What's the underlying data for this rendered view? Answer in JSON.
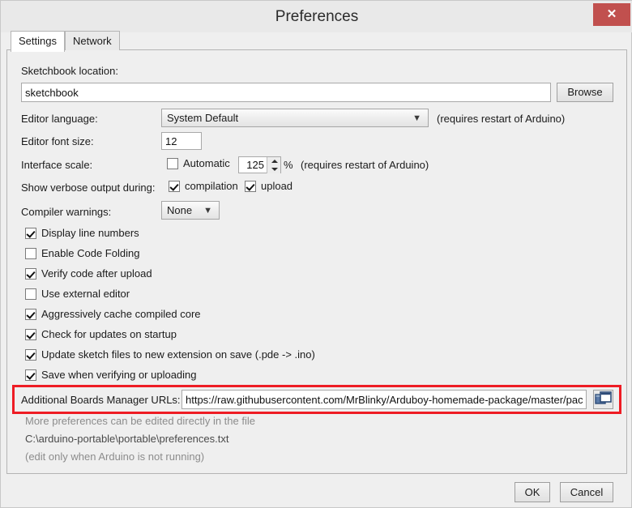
{
  "window": {
    "title": "Preferences",
    "close_label": "✕"
  },
  "tabs": [
    {
      "label": "Settings",
      "active": true
    },
    {
      "label": "Network",
      "active": false
    }
  ],
  "settings": {
    "sketchbook_label": "Sketchbook location:",
    "sketchbook_value": "sketchbook",
    "sketchbook_placeholder": "Sketchbook location",
    "browse_label": "Browse",
    "editor_language_label": "Editor language:",
    "editor_language_value": "System Default",
    "editor_language_note": "(requires restart of Arduino)",
    "editor_font_size_label": "Editor font size:",
    "editor_font_size_value": "12",
    "interface_scale_label": "Interface scale:",
    "interface_scale_auto_label": "Automatic",
    "interface_scale_auto_checked": false,
    "interface_scale_value": "125",
    "interface_scale_percent": "%",
    "interface_scale_note": "(requires restart of Arduino)",
    "verbose_label": "Show verbose output during:",
    "verbose_compilation_label": "compilation",
    "verbose_upload_label": "upload",
    "compiler_warnings_label": "Compiler warnings:",
    "compiler_warnings_value": "None"
  },
  "checkboxes": [
    {
      "label": "Display line numbers",
      "checked": true
    },
    {
      "label": "Enable Code Folding",
      "checked": false
    },
    {
      "label": "Verify code after upload",
      "checked": true
    },
    {
      "label": "Use external editor",
      "checked": false
    },
    {
      "label": "Aggressively cache compiled core",
      "checked": true
    },
    {
      "label": "Check for updates on startup",
      "checked": true
    },
    {
      "label": "Update sketch files to new extension on save (.pde -> .ino)",
      "checked": true
    },
    {
      "label": "Save when verifying or uploading",
      "checked": true
    }
  ],
  "boards_urls": {
    "label": "Additional Boards Manager URLs:",
    "value": "https://raw.githubusercontent.com/MrBlinky/Arduboy-homemade-package/master/pac",
    "placeholder": "Enter a comma separated list of urls",
    "icon": "open-windows-icon",
    "highlight_color": "#ee1c24"
  },
  "footer_hints": {
    "line1": "More preferences can be edited directly in the file",
    "line2": "C:\\arduino-portable\\portable\\preferences.txt",
    "line3": "(edit only when Arduino is not running)"
  },
  "dialog_buttons": {
    "ok_label": "OK",
    "cancel_label": "Cancel"
  }
}
